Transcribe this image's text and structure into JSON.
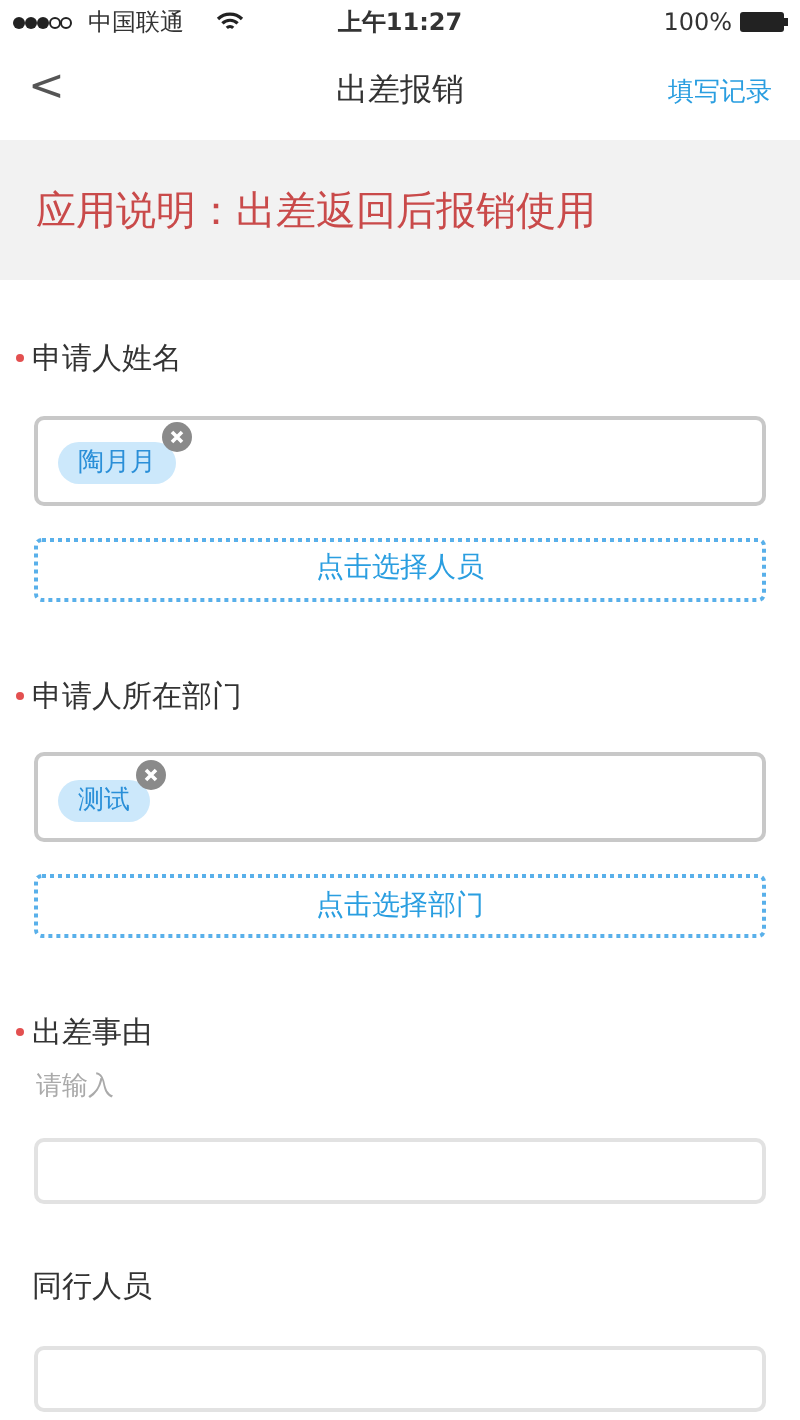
{
  "status_bar": {
    "carrier": "中国联通",
    "time": "上午11:27",
    "battery": "100%"
  },
  "nav": {
    "back": "<",
    "title": "出差报销",
    "action": "填写记录"
  },
  "notice": "应用说明：出差返回后报销使用",
  "fields": [
    {
      "kind": "tags",
      "label": "申请人姓名",
      "required": true,
      "tags": [
        "陶月月"
      ],
      "select_button": "点击选择人员"
    },
    {
      "kind": "tags",
      "label": "申请人所在部门",
      "required": true,
      "tags": [
        "测试"
      ],
      "select_button": "点击选择部门"
    },
    {
      "kind": "text",
      "label": "出差事由",
      "required": true,
      "hint": "请输入"
    },
    {
      "kind": "text",
      "label": "同行人员",
      "required": false
    }
  ]
}
